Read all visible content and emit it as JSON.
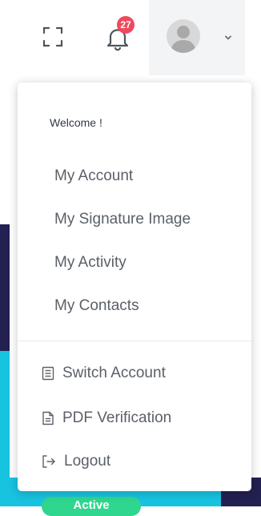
{
  "header": {
    "notifications_count": "27"
  },
  "menu": {
    "welcome": "Welcome !",
    "items": [
      {
        "label": "My Account"
      },
      {
        "label": "My Signature Image"
      },
      {
        "label": "My Activity"
      },
      {
        "label": "My Contacts"
      }
    ],
    "actions": [
      {
        "label": "Switch Account",
        "icon": "list-icon"
      },
      {
        "label": "PDF Verification",
        "icon": "document-icon"
      },
      {
        "label": "Logout",
        "icon": "logout-icon"
      }
    ]
  },
  "background": {
    "status_pill": "Active"
  },
  "colors": {
    "badge": "#ef4a5c",
    "navy": "#232052",
    "cyan": "#18c3e0",
    "green": "#2fd68e",
    "text": "#5b6068"
  }
}
